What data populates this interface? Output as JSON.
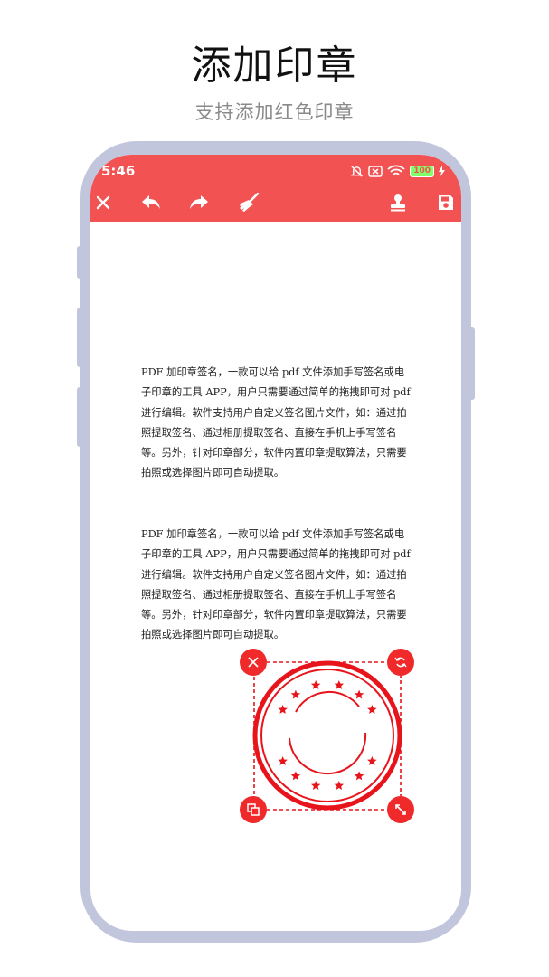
{
  "header": {
    "title": "添加印章",
    "subtitle": "支持添加红色印章"
  },
  "status_bar": {
    "time": "5:46",
    "battery": "100",
    "icons": [
      "mute-bell-icon",
      "sim-off-icon",
      "wifi-icon",
      "battery-icon",
      "charging-bolt-icon"
    ]
  },
  "toolbar": {
    "actions": [
      "close-icon",
      "undo-icon",
      "redo-icon",
      "clear-brush-icon",
      "stamp-icon",
      "save-icon"
    ]
  },
  "document": {
    "paragraphs": [
      "PDF 加印章签名，一款可以给 pdf 文件添加手写签名或电子印章的工具 APP，用户只需要通过简单的拖拽即可对 pdf 进行编辑。软件支持用户自定义签名图片文件，如：通过拍照提取签名、通过相册提取签名、直接在手机上手写签名等。另外，针对印章部分，软件内置印章提取算法，只需要拍照或选择图片即可自动提取。",
      "PDF 加印章签名，一款可以给 pdf 文件添加手写签名或电子印章的工具 APP，用户只需要通过简单的拖拽即可对 pdf 进行编辑。软件支持用户自定义签名图片文件，如：通过拍照提取签名、通过相册提取签名、直接在手机上手写签名等。另外，针对印章部分，软件内置印章提取算法，只需要拍照或选择图片即可自动提取。"
    ]
  },
  "stamp": {
    "color": "#e8141c",
    "handles": [
      "delete-handle",
      "rotate-handle",
      "duplicate-handle",
      "resize-handle"
    ]
  },
  "colors": {
    "accent": "#f35252",
    "frame": "#c2c6dd",
    "handle": "#f02a2a"
  }
}
